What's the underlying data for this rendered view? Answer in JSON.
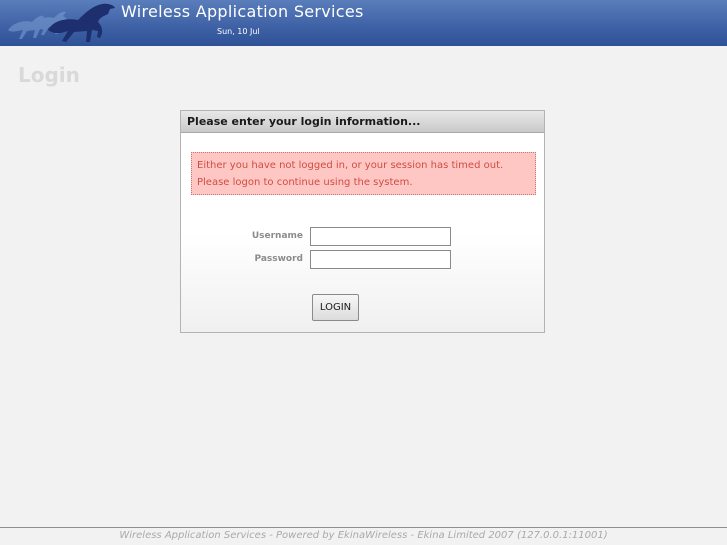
{
  "header": {
    "app_title": "Wireless Application Services",
    "date": "Sun, 10 Jul",
    "logo_icon": "horse-logo-icon"
  },
  "page": {
    "title": "Login"
  },
  "login_panel": {
    "heading": "Please enter your login information...",
    "error_lines": [
      "Either you have not logged in, or your session has timed out.",
      "Please logon to continue using the system."
    ],
    "username_label": "Username",
    "username_value": "",
    "password_label": "Password",
    "password_value": "",
    "login_label": "LOGIN"
  },
  "footer": {
    "text": "Wireless Application Services - Powered by EkinaWireless - Ekina Limited 2007 (127.0.0.1:11001)"
  },
  "colors": {
    "header_blue": "#3f63a6",
    "error_bg": "#ffc7c3",
    "error_text": "#d24b45"
  }
}
